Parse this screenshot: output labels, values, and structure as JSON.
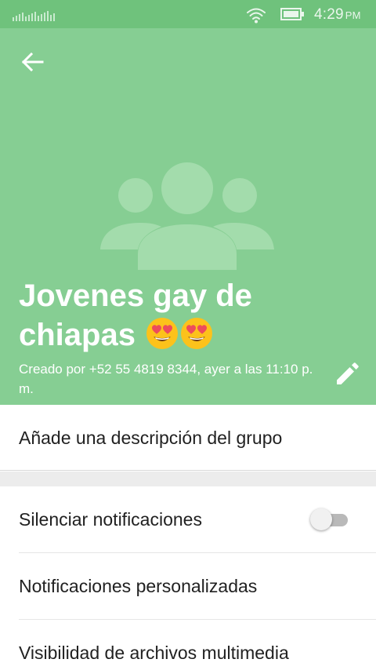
{
  "status_bar": {
    "time": "4:29",
    "ampm": "PM",
    "icons": [
      "signal-icon",
      "wifi-icon",
      "battery-icon"
    ]
  },
  "header": {
    "background_color": "#86ce93",
    "back_icon": "arrow-back-icon",
    "avatar_icon": "group-icon",
    "title_line1": "Jovenes gay de",
    "title_line2": "chiapas",
    "title_emojis": [
      "heart-eyes-emoji",
      "heart-eyes-emoji"
    ],
    "subtitle": "Creado por +52 55 4819 8344, ayer a las 11:10 p. m.",
    "edit_icon": "pencil-icon"
  },
  "description": {
    "label": "Añade una descripción del grupo"
  },
  "settings": {
    "items": [
      {
        "label": "Silenciar notificaciones",
        "toggle": false
      },
      {
        "label": "Notificaciones personalizadas"
      },
      {
        "label": "Visibilidad de archivos multimedia"
      }
    ]
  }
}
